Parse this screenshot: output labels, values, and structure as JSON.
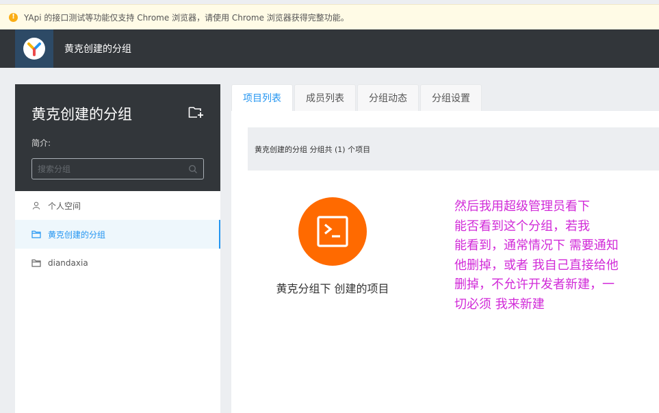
{
  "warning": {
    "text": "YApi 的接口测试等功能仅支持 Chrome 浏览器，请使用 Chrome 浏览器获得完整功能。"
  },
  "header": {
    "title": "黄克创建的分组"
  },
  "sidebar": {
    "group_title": "黄克创建的分组",
    "intro_label": "简介:",
    "search_placeholder": "搜索分组",
    "items": [
      {
        "label": "个人空间",
        "icon": "user-icon"
      },
      {
        "label": "黄克创建的分组",
        "icon": "folder-icon",
        "active": true
      },
      {
        "label": "diandaxia",
        "icon": "folder-icon"
      }
    ]
  },
  "tabs": [
    {
      "label": "项目列表",
      "active": true
    },
    {
      "label": "成员列表"
    },
    {
      "label": "分组动态"
    },
    {
      "label": "分组设置"
    }
  ],
  "summary": {
    "text": "黄克创建的分组 分组共 (1) 个项目"
  },
  "project": {
    "name": "黄克分组下 创建的项目",
    "icon": "terminal-icon",
    "color": "#ff6a00"
  },
  "annotation": {
    "lines": [
      "然后我用超级管理员看下",
      "能否看到这个分组，若我",
      "能看到，通常情况下 需要通知",
      "他删掉，或者 我自己直接给他",
      "删掉，不允许开发者新建，一",
      "切必须 我来新建"
    ],
    "color": "#d12ad8"
  },
  "colors": {
    "accent": "#2395f1",
    "dark": "#32363a",
    "warning_bg": "#fffbe6"
  }
}
